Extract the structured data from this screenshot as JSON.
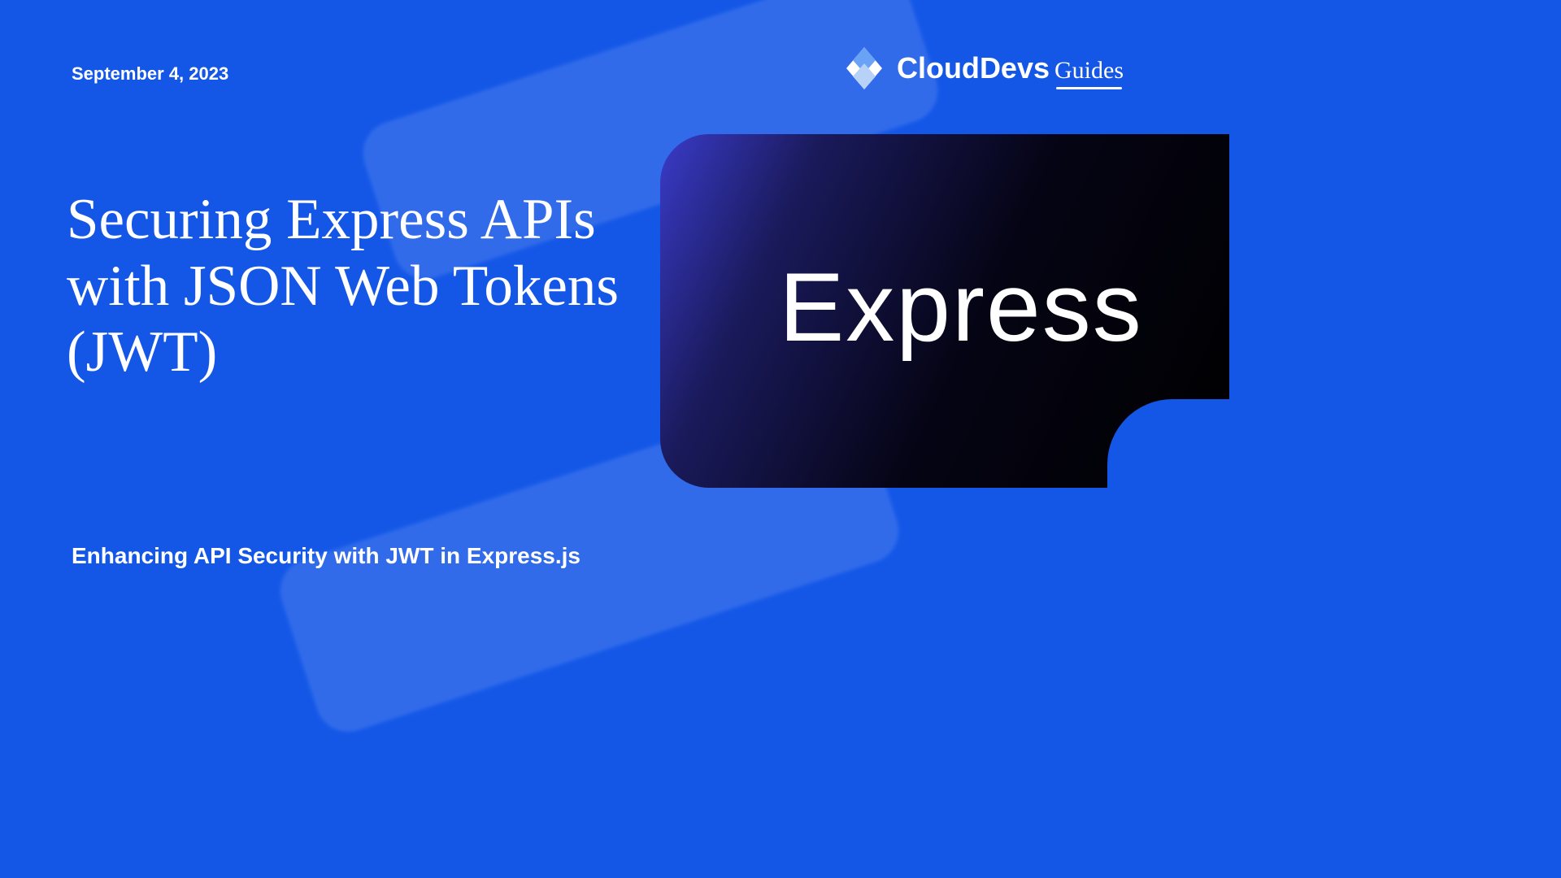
{
  "date": "September 4, 2023",
  "logo": {
    "brand1": "Cloud",
    "brand2": "Devs",
    "suffix": "Guides"
  },
  "title": "Securing Express APIs with JSON Web Tokens (JWT)",
  "subtitle": "Enhancing API Security with JWT in Express.js",
  "card": {
    "label": "Express"
  }
}
